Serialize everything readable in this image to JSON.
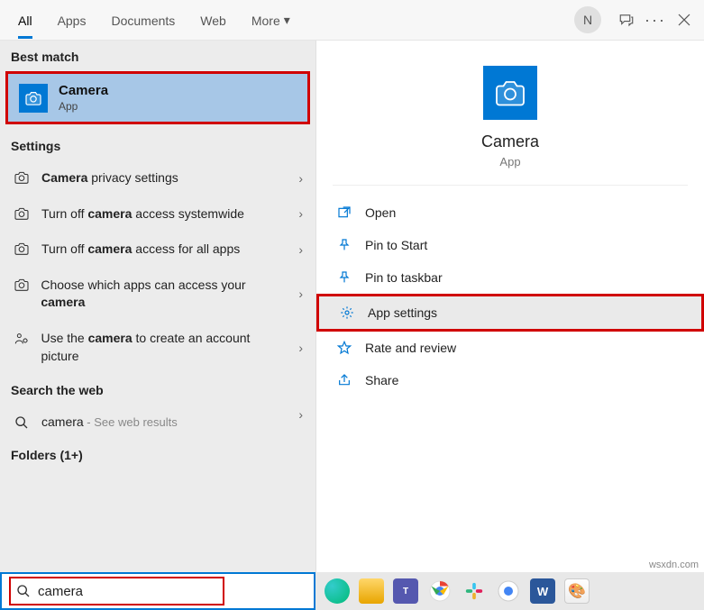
{
  "tabs": {
    "all": "All",
    "apps": "Apps",
    "documents": "Documents",
    "web": "Web",
    "more": "More"
  },
  "user_initial": "N",
  "section_best": "Best match",
  "best_match": {
    "title": "Camera",
    "subtitle": "App"
  },
  "section_settings": "Settings",
  "settings": [
    {
      "pre": "",
      "bold": "Camera",
      "post": " privacy settings"
    },
    {
      "pre": "Turn off ",
      "bold": "camera",
      "post": " access systemwide"
    },
    {
      "pre": "Turn off ",
      "bold": "camera",
      "post": " access for all apps"
    },
    {
      "pre": "Choose which apps can access your ",
      "bold": "camera",
      "post": ""
    },
    {
      "pre": "Use the ",
      "bold": "camera",
      "post": " to create an account picture"
    }
  ],
  "section_web": "Search the web",
  "web": {
    "term": "camera",
    "hint": " - See web results"
  },
  "section_folders": "Folders (1+)",
  "preview": {
    "title": "Camera",
    "subtitle": "App"
  },
  "actions": {
    "open": "Open",
    "pin_start": "Pin to Start",
    "pin_taskbar": "Pin to taskbar",
    "app_settings": "App settings",
    "rate": "Rate and review",
    "share": "Share"
  },
  "search_value": "camera",
  "watermark": "wsxdn.com"
}
